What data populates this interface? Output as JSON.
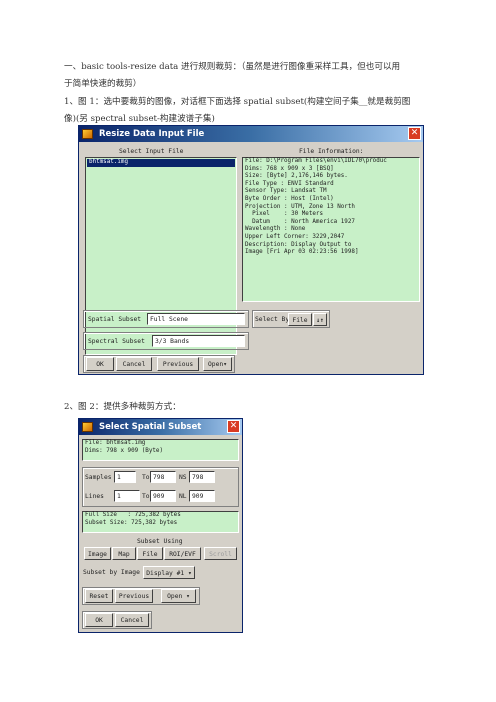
{
  "text": {
    "line1": "一、basic tools-resize data 进行规则裁剪：（虽然是进行图像重采样工具，但也可以用",
    "line2": "于简单快速的裁剪）",
    "line3": "1、图 1：选中要裁剪的图像，对话框下面选择 spatial subset(构建空间子集__就是裁剪图",
    "line4": "像)(另 spectral subset-构建波谱子集)",
    "line5": "2、图 2：提供多种裁剪方式："
  },
  "dialog1": {
    "title": "Resize Data Input File",
    "select_header": "Select Input File",
    "selected_file": "bhtmsat.img",
    "info_header": "File Information:",
    "info_lines": [
      "File: D:\\Program Files\\envi\\IDL70\\produc",
      "Dims: 768 x 909 x 3 [BSQ]",
      "Size: [Byte] 2,176,146 bytes.",
      "File Type : ENVI Standard",
      "Sensor Type: Landsat TM",
      "Byte Order : Host (Intel)",
      "Projection : UTM, Zone 13 North",
      "  Pixel    : 30 Meters",
      "  Datum    : North America 1927",
      "Wavelength : None",
      "Upper Left Corner: 3229,2047",
      "Description: Display Output to",
      "Image [Fri Apr 03 02:23:56 1998]"
    ],
    "spatial_label": "Spatial Subset",
    "spatial_value": "Full Scene",
    "select_by_label": "Select By",
    "select_by_value": "File",
    "spectral_label": "Spectral Subset",
    "spectral_value": "3/3 Bands",
    "ok": "OK",
    "cancel": "Cancel",
    "previous": "Previous",
    "open": "Open"
  },
  "dialog2": {
    "title": "Select Spatial Subset",
    "file_line": "File: bhtmsat.img",
    "dims_line": "Dims: 798 x 909 (Byte)",
    "samples_label": "Samples",
    "samples_from": "1",
    "samples_to_label": "To",
    "samples_to": "798",
    "ns_label": "NS",
    "ns_value": "798",
    "lines_label": "Lines",
    "lines_from": "1",
    "lines_to_label": "To",
    "lines_to": "909",
    "nl_label": "NL",
    "nl_value": "909",
    "full_size": "Full Size   : 725,382 bytes",
    "subset_size": "Subset Size: 725,382 bytes",
    "subset_using": "Subset Using",
    "btn_image": "Image",
    "btn_map": "Map",
    "btn_file": "File",
    "btn_roi": "ROI/EVF",
    "btn_scroll": "Scroll",
    "subset_by_image_label": "Subset by Image",
    "subset_by_image_value": "Display #1",
    "reset": "Reset",
    "previous": "Previous",
    "open": "Open",
    "ok": "OK",
    "cancel": "Cancel"
  }
}
